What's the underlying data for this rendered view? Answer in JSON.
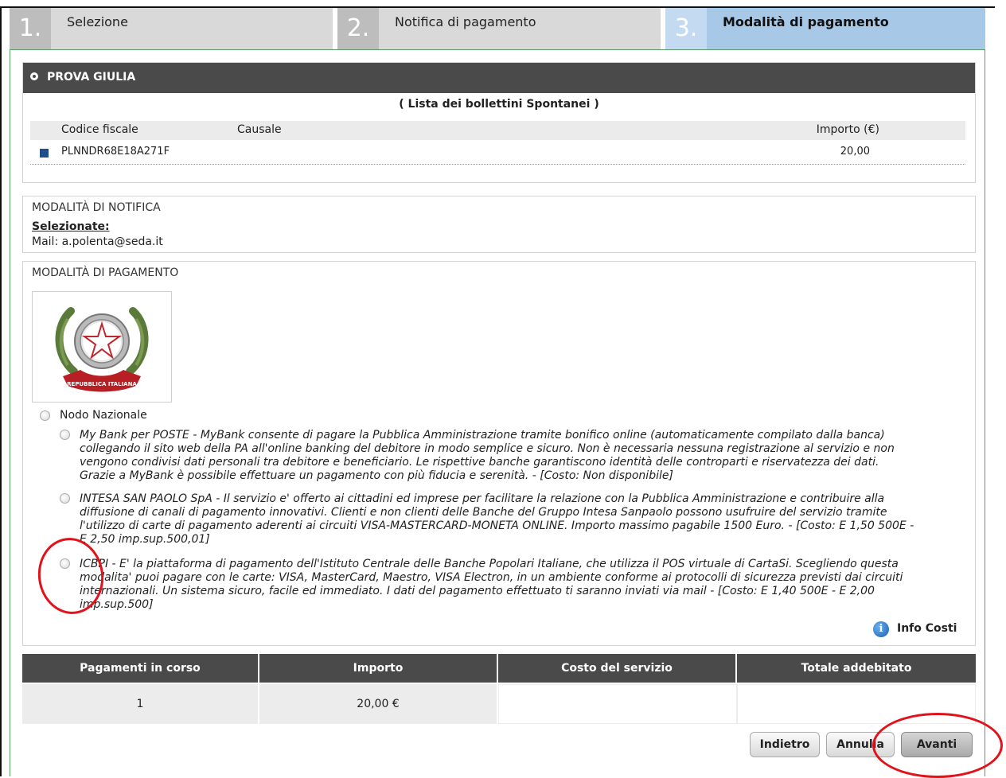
{
  "steps": [
    {
      "num": "1.",
      "label": "Selezione"
    },
    {
      "num": "2.",
      "label": "Notifica di pagamento"
    },
    {
      "num": "3.",
      "label": "Modalità di pagamento"
    }
  ],
  "debtor": {
    "name": "PROVA GIULIA",
    "list_title": "( Lista dei bollettini Spontanei )",
    "columns": {
      "cf": "Codice fiscale",
      "causale": "Causale",
      "importo": "Importo (€)"
    },
    "rows": [
      {
        "cf": "PLNNDR68E18A271F",
        "causale": "",
        "importo": "20,00"
      }
    ]
  },
  "notifica": {
    "title": "MODALITÀ DI NOTIFICA",
    "selected_label": "Selezionate:",
    "mail": "Mail: a.polenta@seda.it"
  },
  "pagamento": {
    "title": "MODALITÀ DI PAGAMENTO",
    "emblem_text": "REPUBBLICA ITALIANA",
    "nodo_label": "Nodo Nazionale",
    "options": [
      "My Bank per POSTE - MyBank consente di pagare la Pubblica Amministrazione tramite bonifico online (automaticamente compilato dalla banca) collegando il sito web della PA all'online banking del debitore in modo semplice e sicuro. Non è necessaria nessuna registrazione al servizio e non vengono condivisi dati personali tra debitore e beneficiario. Le rispettive banche garantiscono identità delle controparti e riservatezza dei dati. Grazie a MyBank è possibile effettuare un pagamento con più fiducia e serenità. - [Costo: Non disponibile]",
      "INTESA SAN PAOLO SpA - Il servizio e' offerto ai cittadini ed imprese per facilitare la relazione con la Pubblica Amministrazione e contribuire alla diffusione di canali di pagamento innovativi. Clienti e non clienti delle Banche del Gruppo Intesa Sanpaolo possono usufruire del servizio tramite l'utilizzo di carte di pagamento aderenti ai circuiti VISA-MASTERCARD-MONETA ONLINE. Importo massimo pagabile 1500 Euro. - [Costo: E 1,50 500E - E 2,50 imp.sup.500,01]",
      "ICBPI - E' la piattaforma di pagamento dell'Istituto Centrale delle Banche Popolari Italiane, che utilizza il POS virtuale di CartaSi. Scegliendo questa modalita' puoi pagare con le carte: VISA, MasterCard, Maestro, VISA Electron, in un ambiente conforme ai protocolli di sicurezza previsti dai circuiti internazionali. Un sistema sicuro, facile ed immediato. I dati del pagamento effettuato ti saranno inviati via mail - [Costo: E 1,40 500E - E 2,00 imp.sup.500]"
    ],
    "info_costi": "Info Costi"
  },
  "summary": {
    "headers": [
      "Pagamenti in corso",
      "Importo",
      "Costo del servizio",
      "Totale addebitato"
    ],
    "values": [
      "1",
      "20,00 €",
      "",
      ""
    ]
  },
  "buttons": {
    "back": "Indietro",
    "cancel": "Annulla",
    "next": "Avanti"
  },
  "colors": {
    "header_dark": "#4a4a4a",
    "active_step": "#a8c8e8",
    "annotation": "#e1121a"
  }
}
